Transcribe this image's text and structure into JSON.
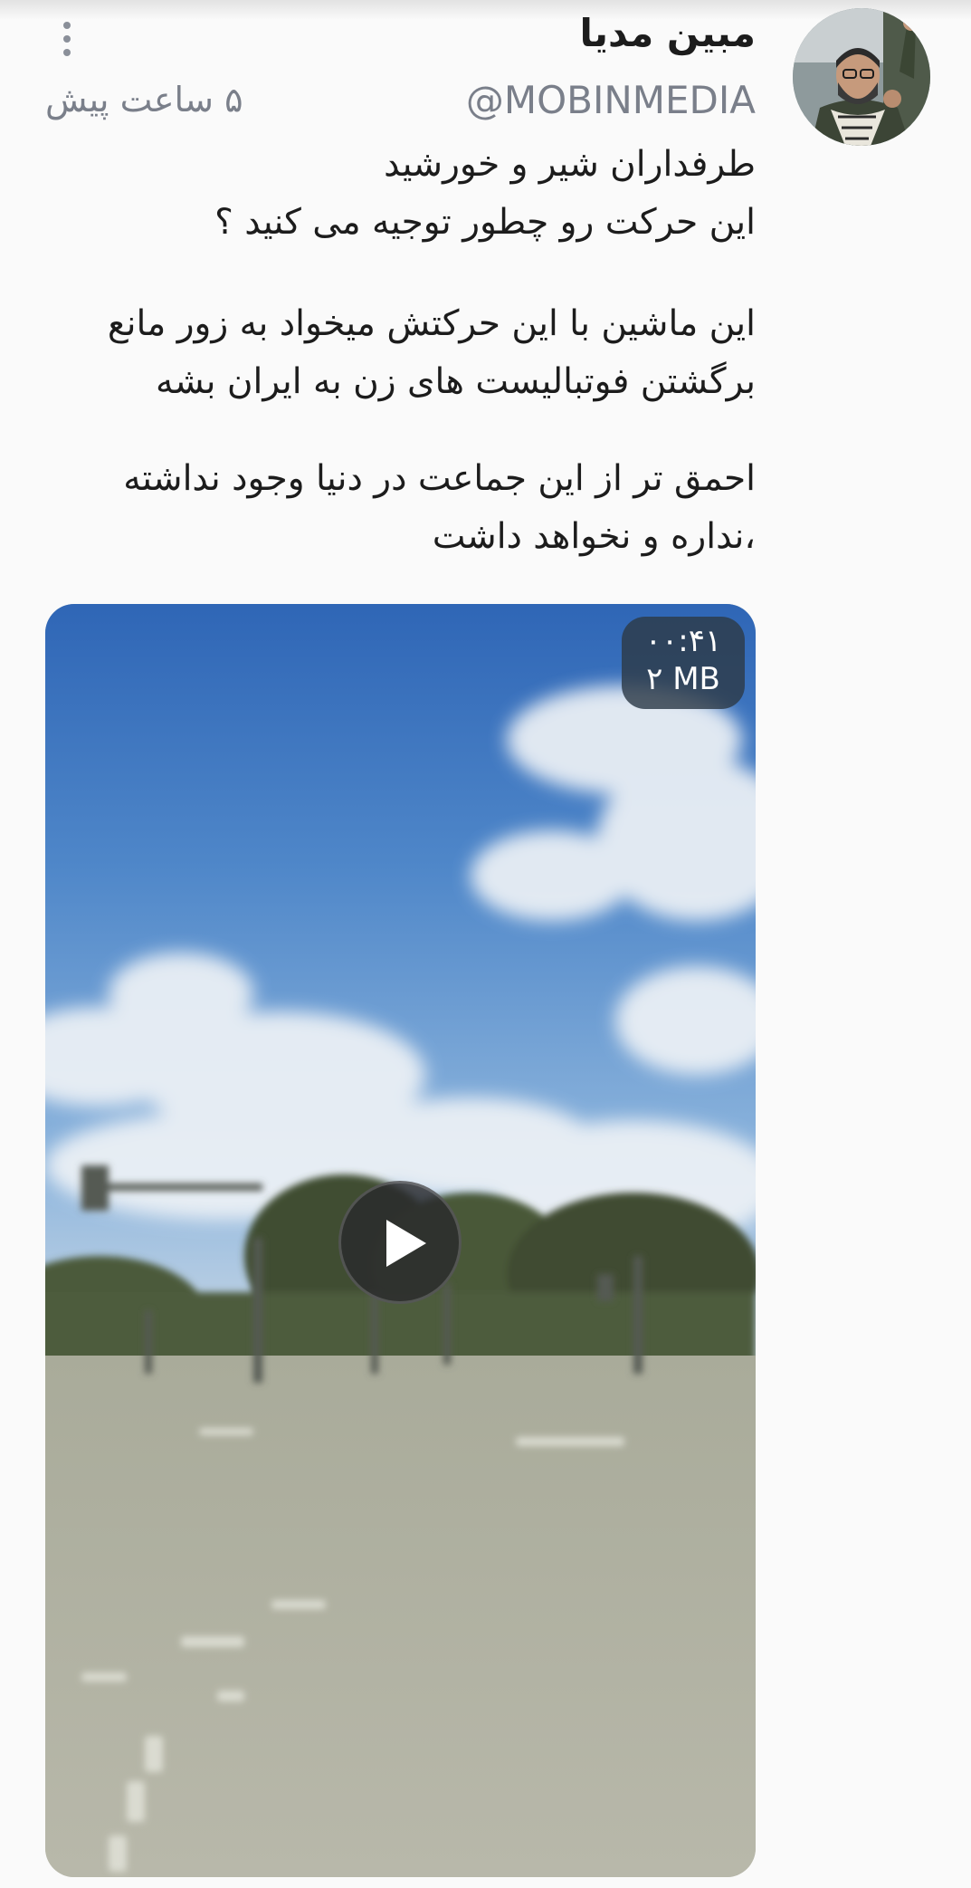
{
  "post": {
    "author": {
      "display_name": "مبین مدیا",
      "handle": "@MOBINMEDIA"
    },
    "timestamp": "۵ ساعت پیش",
    "icons": {
      "avatar": "avatar-image",
      "more": "more-vertical-icon",
      "play": "play-icon"
    },
    "text": {
      "p1_l1": "طرفداران شیر و خورشید",
      "p1_l2": "این حرکت رو چطور توجیه می کنید ؟",
      "p2_l1": "این ماشین با این حرکتش میخواد به زور مانع",
      "p2_l2": "برگشتن فوتبالیست های زن به ایران بشه",
      "p3_l1": "احمق تر از این جماعت در دنیا وجود نداشته",
      "p3_l2": "،نداره و نخواهد داشت"
    },
    "video": {
      "duration": "۰۰:۴۱",
      "size": "۲ MB"
    }
  },
  "colors": {
    "background": "#fafafa",
    "text_primary": "#1c1c1c",
    "text_secondary": "#7a7f8a",
    "badge_bg": "#2d3a48"
  }
}
